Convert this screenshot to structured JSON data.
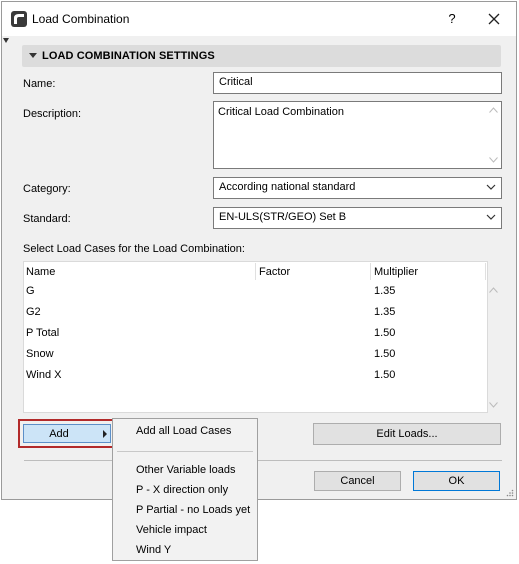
{
  "window": {
    "title": "Load Combination",
    "help_label": "?",
    "close_icon": "close-icon"
  },
  "section": {
    "title": "LOAD COMBINATION SETTINGS"
  },
  "form": {
    "name_label": "Name:",
    "name_value": "Critical",
    "description_label": "Description:",
    "description_value": "Critical Load Combination",
    "category_label": "Category:",
    "category_value": "According national standard",
    "standard_label": "Standard:",
    "standard_value": "EN-ULS(STR/GEO) Set B"
  },
  "load_cases": {
    "caption": "Select Load Cases for the Load Combination:",
    "columns": [
      "Name",
      "Factor",
      "Multiplier"
    ],
    "rows": [
      {
        "name": "G",
        "factor": "",
        "multiplier": "1.35"
      },
      {
        "name": "G2",
        "factor": "",
        "multiplier": "1.35"
      },
      {
        "name": "P Total",
        "factor": "",
        "multiplier": "1.50"
      },
      {
        "name": "Snow",
        "factor": "",
        "multiplier": "1.50"
      },
      {
        "name": "Wind X",
        "factor": "",
        "multiplier": "1.50"
      }
    ]
  },
  "buttons": {
    "add": "Add",
    "edit_loads": "Edit Loads...",
    "cancel": "Cancel",
    "ok": "OK"
  },
  "add_menu": {
    "items": [
      "Add all Load Cases",
      "Other Variable loads",
      "P - X direction only",
      "P Partial - no Loads yet",
      "Vehicle impact",
      "Wind Y"
    ]
  },
  "colors": {
    "dialog_bg": "#f0f0f0",
    "section_bg": "#dcdcdc",
    "add_button_bg": "#cce4f7",
    "highlight_outline": "#b22a2a",
    "ok_border": "#0078d7"
  }
}
